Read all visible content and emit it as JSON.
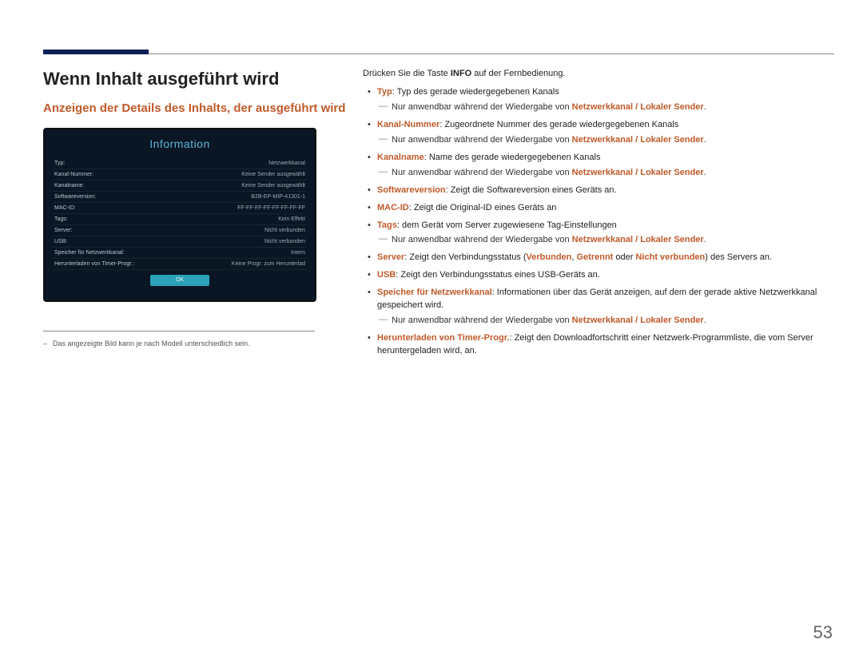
{
  "page_number": "53",
  "h1": "Wenn Inhalt ausgeführt wird",
  "h2": "Anzeigen der Details des Inhalts, der ausgeführt wird",
  "screenshot": {
    "title": "Information",
    "rows": [
      {
        "label": "Typ:",
        "value": "Netzwerkkanal"
      },
      {
        "label": "Kanal-Nummer:",
        "value": "Keine Sender ausgewählt"
      },
      {
        "label": "Kanalname:",
        "value": "Keine Sender ausgewählt"
      },
      {
        "label": "Softwareversion:",
        "value": "B2B-EP-MIP-41301-1"
      },
      {
        "label": "MAC-ID:",
        "value": "FF-FF-FF-FF-FF-FF-FF-FF"
      },
      {
        "label": "Tags:",
        "value": "Kein Effekt"
      },
      {
        "label": "Server:",
        "value": "Nicht verbunden"
      },
      {
        "label": "USB:",
        "value": "Nicht verbunden"
      },
      {
        "label": "Speicher für Netzwerkkanal:",
        "value": "Intern"
      },
      {
        "label": "Herunterladen von Timer-Progr.:",
        "value": "Keine Progr. zum Herunterlad"
      }
    ],
    "ok": "OK"
  },
  "footnote": "Das angezeigte Bild kann je nach Modell unterschiedlich sein.",
  "intro_a": "Drücken Sie die Taste ",
  "intro_b": "INFO",
  "intro_c": " auf der Fernbedienung.",
  "applicable_prefix": "Nur anwendbar während der Wiedergabe von ",
  "applicable_link": "Netzwerkkanal / Lokaler Sender",
  "items": {
    "typ": {
      "term": "Typ",
      "rest": ": Typ des gerade wiedergegebenen Kanals"
    },
    "kanalnummer": {
      "term": "Kanal-Nummer",
      "rest": ": Zugeordnete Nummer des gerade wiedergegebenen Kanals"
    },
    "kanalname": {
      "term": "Kanalname",
      "rest": ": Name des gerade wiedergegebenen Kanals"
    },
    "softwareversion": {
      "term": "Softwareversion",
      "rest": ": Zeigt die Softwareversion eines Geräts an."
    },
    "macid": {
      "term": "MAC-ID",
      "rest": ": Zeigt die Original-ID eines Geräts an"
    },
    "tags": {
      "term": "Tags",
      "rest": ": dem Gerät vom Server zugewiesene Tag-Einstellungen"
    },
    "server": {
      "term": "Server",
      "a": ": Zeigt den Verbindungsstatus (",
      "s1": "Verbunden",
      "c1": ", ",
      "s2": "Getrennt",
      "c2": " oder ",
      "s3": "Nicht verbunden",
      "b": ") des Servers an."
    },
    "usb": {
      "term": "USB",
      "rest": ": Zeigt den Verbindungsstatus eines USB-Geräts an."
    },
    "speicher": {
      "term": "Speicher für Netzwerkkanal",
      "rest": ": Informationen über das Gerät anzeigen, auf dem der gerade aktive Netzwerkkanal gespeichert wird."
    },
    "herunterladen": {
      "term": "Herunterladen von Timer-Progr.",
      "rest": ": Zeigt den Downloadfortschritt einer Netzwerk-Programmliste, die vom Server heruntergeladen wird, an."
    }
  }
}
